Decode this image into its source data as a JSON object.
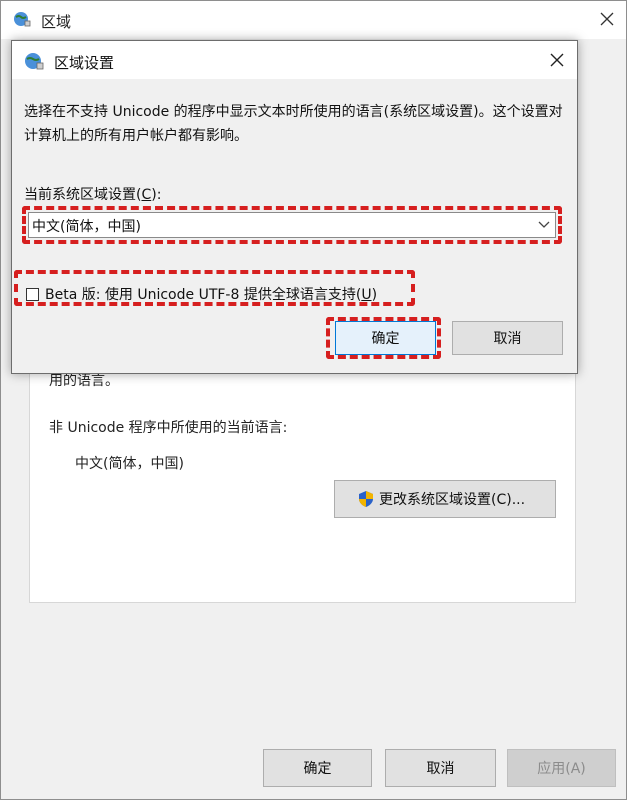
{
  "outer_window": {
    "title": "区域",
    "title_icon": "globe-icon",
    "partial_text": "用的语言。",
    "current_lang_label": "非 Unicode 程序中所使用的当前语言:",
    "current_lang_value": "中文(简体，中国)",
    "change_button": "更改系统区域设置(C)...",
    "ok_button": "确定",
    "cancel_button": "取消",
    "apply_button": "应用(A)"
  },
  "dialog": {
    "title": "区域设置",
    "title_icon": "globe-icon",
    "description": "选择在不支持 Unicode 的程序中显示文本时所使用的语言(系统区域设置)。这个设置对计算机上的所有用户帐户都有影响。",
    "locale_label_prefix": "当前系统区域设置(",
    "locale_label_key": "C",
    "locale_label_suffix": "):",
    "locale_selected": "中文(简体，中国)",
    "beta_label_prefix": "Beta 版: 使用 Unicode UTF-8 提供全球语言支持(",
    "beta_label_key": "U",
    "beta_label_suffix": ")",
    "beta_checked": false,
    "ok_button": "确定",
    "cancel_button": "取消"
  },
  "colors": {
    "highlight": "#d61f1f",
    "dialog_bg": "#f0f0f0",
    "button_bg": "#e1e1e1",
    "focus_border": "#0078d7"
  }
}
